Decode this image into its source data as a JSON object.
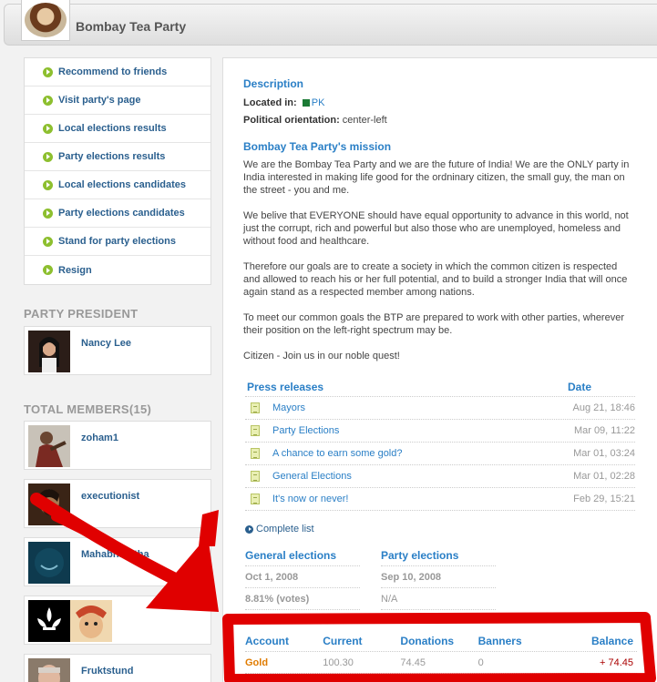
{
  "header": {
    "title": "Bombay Tea Party"
  },
  "menu": [
    "Recommend to friends",
    "Visit party's page",
    "Local elections results",
    "Party elections results",
    "Local elections candidates",
    "Party elections candidates",
    "Stand for party elections",
    "Resign"
  ],
  "president": {
    "section_title": "PARTY PRESIDENT",
    "name": "Nancy Lee"
  },
  "members": {
    "section_title": "TOTAL MEMBERS(15)",
    "list": [
      "zoham1",
      "executionist",
      "Mahabharatha",
      "",
      "Fruktstund"
    ]
  },
  "description": {
    "title": "Description",
    "located_label": "Located in:",
    "located_value": "PK",
    "orientation_label": "Political orientation:",
    "orientation_value": "center-left"
  },
  "mission": {
    "title": "Bombay Tea Party's mission",
    "p1": "We are the Bombay Tea Party and we are the future of India! We are the ONLY party in India interested in making life good for the ordninary citizen, the small guy, the man on the street - you and me.",
    "p2": "We belive that EVERYONE should have equal opportunity to advance in this world, not just the corrupt, rich and powerful but also those who are unemployed, homeless and without food and healthcare.",
    "p3": "Therefore our goals are to create a society in which the common citizen is respected and allowed to reach his or her full potential, and to build a stronger India that will once again stand as a respected member among nations.",
    "p4": "To meet our common goals the BTP are prepared to work with other parties, wherever their position on the left-right spectrum may be.",
    "p5": "Citizen - Join us in our noble quest!"
  },
  "press": {
    "title_header": "Press releases",
    "date_header": "Date",
    "items": [
      {
        "title": "Mayors",
        "date": "Aug 21, 18:46"
      },
      {
        "title": "Party Elections",
        "date": "Mar 09, 11:22"
      },
      {
        "title": "A chance to earn some gold?",
        "date": "Mar 01, 03:24"
      },
      {
        "title": "General Elections",
        "date": "Mar 01, 02:28"
      },
      {
        "title": "It's now or never!",
        "date": "Feb 29, 15:21"
      }
    ],
    "complete_list": "Complete list"
  },
  "elections": {
    "general": {
      "title": "General elections",
      "date": "Oct 1, 2008",
      "votes": "8.81% (votes)"
    },
    "party": {
      "title": "Party elections",
      "date": "Sep 10, 2008",
      "votes": "N/A"
    }
  },
  "account": {
    "headers": [
      "Account",
      "Current",
      "Donations",
      "Banners",
      "Balance"
    ],
    "row": [
      "Gold",
      "100.30",
      "74.45",
      "0",
      "+ 74.45"
    ]
  },
  "colors": {
    "link": "#2a7fc6",
    "menu": "#2a5f8e",
    "gold": "#e07b00",
    "marker": "#e00000",
    "bullet": "#8dbf2f"
  }
}
